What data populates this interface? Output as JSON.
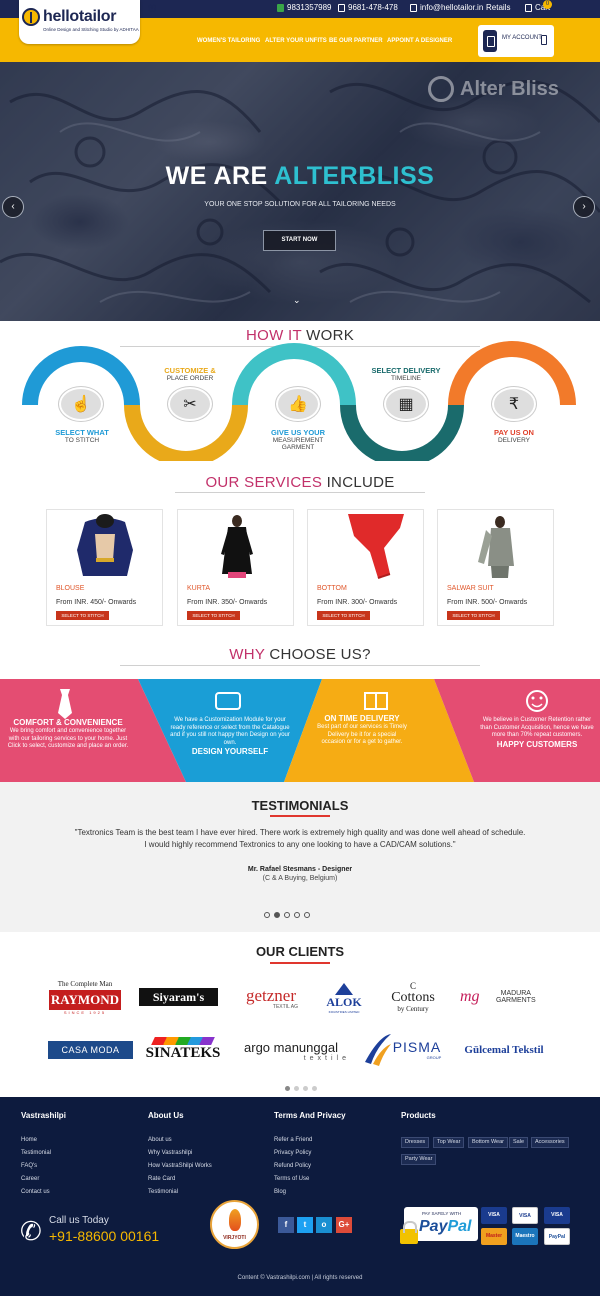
{
  "topbar": {
    "phone1": "9831357989",
    "phone2": "9681-478-478",
    "email": "info@hellotailor.in",
    "retails": "Retails",
    "cart": "Cart",
    "cart_count": "0"
  },
  "logo": {
    "name": "hellotailor",
    "tagline": "Online Design and Stitching Studio by ADHITAA"
  },
  "nav": [
    "WOMEN'S TAILORING",
    "ALTER YOUR UNFITS",
    "BE OUR PARTNER",
    "APPOINT A DESIGNER"
  ],
  "account": {
    "label": "MY ACCOUNT"
  },
  "hero": {
    "watermark": "Alter Bliss",
    "title_part1": "WE ARE ",
    "title_part2": "ALTERBLISS",
    "subtitle": "YOUR ONE STOP SOLUTION FOR ALL TAILORING NEEDS",
    "button": "START NOW",
    "prev": "‹",
    "next": "›",
    "down": "⌄"
  },
  "how": {
    "title_part1": "HOW IT ",
    "title_part2": "WORK",
    "steps": [
      {
        "head": "SELECT WHAT",
        "sub": "TO STITCH",
        "color": "#1f9ad6",
        "icon": "hand-pointer-icon"
      },
      {
        "head": "CUSTOMIZE &",
        "sub": "PLACE ORDER",
        "color": "#e9a91a",
        "icon": "scissors-icon"
      },
      {
        "head": "GIVE US YOUR",
        "sub": "MEASUREMENT GARMENT",
        "color": "#1f9ad6",
        "icon": "thumbs-up-icon"
      },
      {
        "head": "SELECT DELIVERY",
        "sub": "TIMELINE",
        "color": "#1a6b6c",
        "icon": "calendar-icon"
      },
      {
        "head": "PAY US ON",
        "sub": "DELIVERY",
        "color": "#e0412b",
        "icon": "rupee-icon"
      }
    ]
  },
  "services": {
    "title_part1": "OUR SERVICES ",
    "title_part2": "INCLUDE",
    "button": "SELECT TO STITCH",
    "items": [
      {
        "name": "BLOUSE",
        "price": "From INR. 450/- Onwards"
      },
      {
        "name": "KURTA",
        "price": "From INR. 350/- Onwards"
      },
      {
        "name": "BOTTOM",
        "price": "From INR. 300/- Onwards"
      },
      {
        "name": "SALWAR SUIT",
        "price": "From INR. 500/- Onwards"
      }
    ]
  },
  "why": {
    "title_part1": "WHY ",
    "title_part2": "CHOOSE US?",
    "panels": [
      {
        "head": "COMFORT & CONVENIENCE",
        "text": "We bring comfort and convenience together with our tailoring services to your home. Just Click to select, customize and place an order.",
        "color": "#e44d72",
        "icon": "tie-icon"
      },
      {
        "head": "DESIGN YOURSELF",
        "text": "We have a Customization Module for your ready reference or select from the Catalogue and if you still not happy then Design on your own.",
        "color": "#1a9ed6",
        "icon": "hand-icon"
      },
      {
        "head": "ON TIME DELIVERY",
        "text": "Best part of our services is Timely Delivery be it for a special occasion or for a get to gather.",
        "color": "#f6ac14",
        "icon": "book-icon"
      },
      {
        "head": "HAPPY CUSTOMERS",
        "text": "We believe in Customer Retention rather than Customer Acquisition, hence we have more than 70% repeat customers.",
        "color": "#e44d72",
        "icon": "smile-icon"
      }
    ]
  },
  "testimonials": {
    "title": "TESTIMONIALS",
    "quote_line1": "\"Textronics Team is the best team I have ever hired. There work is extremely high quality and was done well ahead of schedule.",
    "quote_line2": "I would highly recommend Textronics to any one looking to have a CAD/CAM solutions.\"",
    "author": "Mr. Rafael Stesmans - Designer",
    "company": "(C & A Buying, Belgium)"
  },
  "clients": {
    "title": "OUR CLIENTS",
    "row1": [
      {
        "top": "The Complete Man",
        "name": "RAYMOND",
        "sub": "SINCE 1925"
      },
      {
        "name": "Siyaram's"
      },
      {
        "name": "getzner",
        "sub": "TEXTIL AG"
      },
      {
        "name": "ALOK",
        "sub": "INDUSTRIES LIMITED"
      },
      {
        "name": "Cottons",
        "sub": "by Century"
      },
      {
        "name": "MADURA GARMENTS"
      }
    ],
    "row2": [
      {
        "name": "CASA MODA"
      },
      {
        "name": "SINATEKS"
      },
      {
        "name": "argo manunggal",
        "sub": "textile"
      },
      {
        "name": "PISMA",
        "sub": "GROUP"
      },
      {
        "name": "Gülcemal Tekstil"
      }
    ]
  },
  "footer": {
    "col1": {
      "head": "Vastrashilpi",
      "links": [
        "Home",
        "Testimonial",
        "FAQ's",
        "Career",
        "Contact us"
      ]
    },
    "col2": {
      "head": "About Us",
      "links": [
        "About us",
        "Why Vastrashilpi",
        "How VastraShilpi Works",
        "Rate Card",
        "Testimonial"
      ]
    },
    "col3": {
      "head": "Terms And Privacy",
      "links": [
        "Refer a Friend",
        "Privacy Policy",
        "Refund Policy",
        "Terms of Use",
        "Blog"
      ]
    },
    "col4": {
      "head": "Products",
      "tags": [
        "Dresses",
        "Top Wear",
        "Bottom Wear",
        "Sale",
        "Accessories",
        "Party Wear"
      ]
    },
    "call_label": "Call us Today",
    "call_number": "+91-88600 00161",
    "brand_logo_text": "VIRJYOTI",
    "social": [
      "f",
      "t",
      "o",
      "G+"
    ],
    "paypal_small": "PAY SAFELY WITH",
    "paypal_pay": "Pay",
    "paypal_pal": "Pal",
    "cards": [
      "VISA",
      "VISA",
      "VISA",
      "Master",
      "Maestro",
      "PayPal"
    ],
    "copyright": "Content © Vastrashilpi.com | All rights reserved"
  },
  "colors": {
    "brand_yellow": "#f6b800",
    "navy": "#1d2753",
    "accent_pink": "#c2316a",
    "teal": "#2ec0d0"
  }
}
